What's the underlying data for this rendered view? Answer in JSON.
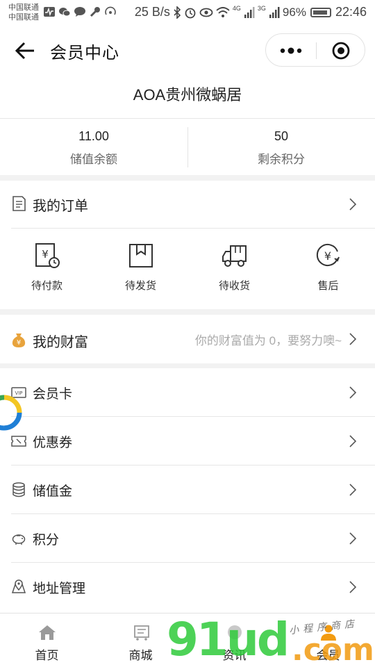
{
  "status_bar": {
    "carrier_1": "中国联通",
    "carrier_2": "中国联通",
    "net_speed": "25 B/s",
    "net_4g": "4G",
    "net_3g": "3G",
    "battery": "96%",
    "time": "22:46"
  },
  "nav": {
    "title": "会员中心",
    "back_icon": "arrow-left-icon",
    "more_icon": "more-dots-icon",
    "close_icon": "target-close-icon"
  },
  "shop": {
    "name": "AOA贵州微蜗居"
  },
  "stats": [
    {
      "value": "11.00",
      "label": "储值余额"
    },
    {
      "value": "50",
      "label": "剩余积分"
    }
  ],
  "orders": {
    "title": "我的订单",
    "items": [
      {
        "label": "待付款",
        "icon": "pending-payment-icon"
      },
      {
        "label": "待发货",
        "icon": "pending-shipment-icon"
      },
      {
        "label": "待收货",
        "icon": "truck-icon"
      },
      {
        "label": "售后",
        "icon": "refund-icon"
      }
    ]
  },
  "wealth": {
    "title": "我的财富",
    "hint": "你的财富值为 0，要努力噢~",
    "icon": "money-bag-icon"
  },
  "menu": [
    {
      "label": "会员卡",
      "icon": "vip-card-icon"
    },
    {
      "label": "优惠券",
      "icon": "coupon-icon"
    },
    {
      "label": "储值金",
      "icon": "coins-stack-icon"
    },
    {
      "label": "积分",
      "icon": "piggy-bank-icon"
    },
    {
      "label": "地址管理",
      "icon": "map-pin-icon"
    }
  ],
  "tabs": [
    {
      "label": "首页",
      "icon": "home-icon"
    },
    {
      "label": "商城",
      "icon": "shop-cart-icon"
    },
    {
      "label": "资讯",
      "icon": "news-icon"
    },
    {
      "label": "会员",
      "icon": "member-icon"
    }
  ],
  "watermark": {
    "main": "91ud",
    "suffix": ".com",
    "script": "小程序商店"
  },
  "colors": {
    "accent_green": "#2ecb3a",
    "accent_orange": "#f29b10",
    "wealth_icon": "#e8a33c",
    "loader_blue": "#1f7fd6",
    "loader_yellow": "#f3c623",
    "loader_green": "#3aa655"
  }
}
